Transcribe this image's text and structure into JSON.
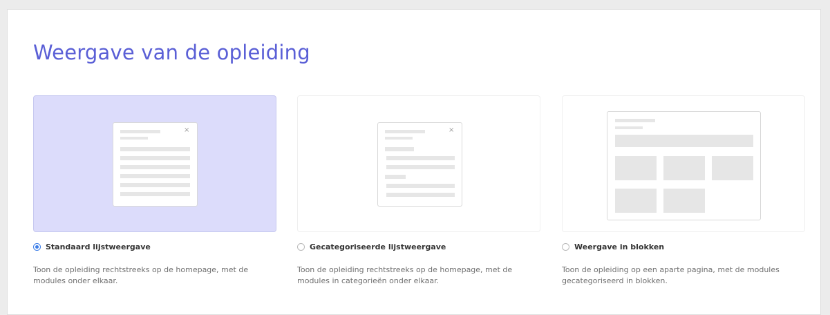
{
  "page": {
    "title": "Weergave van de opleiding"
  },
  "options": [
    {
      "label": "Standaard lijstweergave",
      "description": "Toon de opleiding rechtstreeks op de homepage, met de modules onder elkaar.",
      "selected": true,
      "preview_icon": "list-layout-preview"
    },
    {
      "label": "Gecategoriseerde lijstweergave",
      "description": "Toon de opleiding rechtstreeks op de homepage, met de modules in categorieën onder elkaar.",
      "selected": false,
      "preview_icon": "categorized-list-layout-preview"
    },
    {
      "label": "Weergave in blokken",
      "description": "Toon de opleiding op een aparte pagina, met de modules gecategoriseerd in blokken.",
      "selected": false,
      "preview_icon": "blocks-layout-preview"
    }
  ],
  "icons": {
    "close": "×"
  },
  "colors": {
    "title": "#5a5fd6",
    "selected_card": "#dcdcfb",
    "radio_checked": "#3b7de8"
  }
}
